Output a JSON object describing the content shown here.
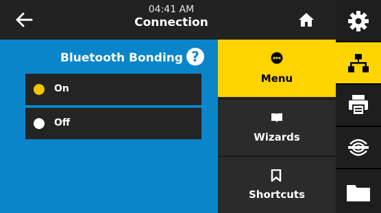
{
  "header": {
    "time": "04:41 AM",
    "title": "Connection"
  },
  "setting": {
    "title": "Bluetooth Bonding",
    "help_icon": "?",
    "options": [
      {
        "label": "On",
        "selected": true
      },
      {
        "label": "Off",
        "selected": false
      }
    ]
  },
  "menu": {
    "items": [
      {
        "label": "Menu",
        "icon": "dots-circle-icon",
        "active": true
      },
      {
        "label": "Wizards",
        "icon": "book-icon",
        "active": false
      },
      {
        "label": "Shortcuts",
        "icon": "bookmark-icon",
        "active": false
      }
    ]
  },
  "sidebar": {
    "items": [
      {
        "icon": "gear-icon",
        "active": false
      },
      {
        "icon": "network-icon",
        "active": true
      },
      {
        "icon": "printer-icon",
        "active": false
      },
      {
        "icon": "rfid-icon",
        "active": false
      },
      {
        "icon": "folder-icon",
        "active": false
      }
    ]
  },
  "colors": {
    "accent": "#ffd400",
    "panel": "#0a85c9",
    "dark": "#222222"
  }
}
